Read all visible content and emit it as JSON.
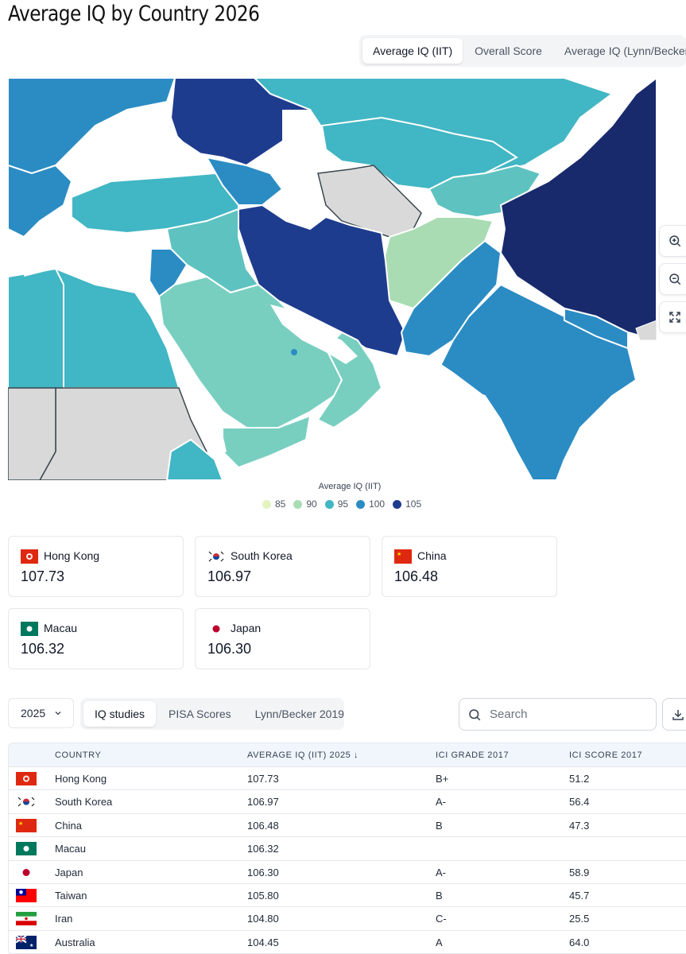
{
  "page_title": "Average IQ by Country 2026",
  "map_tabs": [
    {
      "label": "Average IQ (IIT)",
      "active": true
    },
    {
      "label": "Overall Score",
      "active": false
    },
    {
      "label": "Average IQ (Lynn/Becker)",
      "active": false
    }
  ],
  "map_controls": {
    "zoom_in": "zoom-in-icon",
    "zoom_out": "zoom-out-icon",
    "fullscreen": "expand-icon"
  },
  "legend": {
    "title": "Average IQ (IIT)",
    "items": [
      {
        "label": "85",
        "color": "#e3f4c0"
      },
      {
        "label": "90",
        "color": "#a9dcb3"
      },
      {
        "label": "95",
        "color": "#41b6c4"
      },
      {
        "label": "100",
        "color": "#2b8cc4"
      },
      {
        "label": "105",
        "color": "#1e3c8e"
      }
    ]
  },
  "top_cards": [
    {
      "country": "Hong Kong",
      "value": "107.73",
      "flag": "hong-kong"
    },
    {
      "country": "South Korea",
      "value": "106.97",
      "flag": "south-korea"
    },
    {
      "country": "China",
      "value": "106.48",
      "flag": "china"
    },
    {
      "country": "Macau",
      "value": "106.32",
      "flag": "macau"
    },
    {
      "country": "Japan",
      "value": "106.30",
      "flag": "japan"
    }
  ],
  "controls": {
    "year": "2025",
    "data_tabs": [
      {
        "label": "IQ studies",
        "active": true
      },
      {
        "label": "PISA Scores",
        "active": false
      },
      {
        "label": "Lynn/Becker 2019",
        "active": false
      }
    ],
    "search_placeholder": "Search"
  },
  "table": {
    "headers": [
      "Country",
      "Average IQ (IIT) 2025 ↓",
      "ICI Grade 2017",
      "ICI Score 2017"
    ],
    "rows": [
      {
        "country": "Hong Kong",
        "iq": "107.73",
        "grade": "B+",
        "score": "51.2",
        "flag": "hong-kong"
      },
      {
        "country": "South Korea",
        "iq": "106.97",
        "grade": "A-",
        "score": "56.4",
        "flag": "south-korea"
      },
      {
        "country": "China",
        "iq": "106.48",
        "grade": "B",
        "score": "47.3",
        "flag": "china"
      },
      {
        "country": "Macau",
        "iq": "106.32",
        "grade": "",
        "score": "",
        "flag": "macau"
      },
      {
        "country": "Japan",
        "iq": "106.30",
        "grade": "A-",
        "score": "58.9",
        "flag": "japan"
      },
      {
        "country": "Taiwan",
        "iq": "105.80",
        "grade": "B",
        "score": "45.7",
        "flag": "taiwan"
      },
      {
        "country": "Iran",
        "iq": "104.80",
        "grade": "C-",
        "score": "25.5",
        "flag": "iran"
      },
      {
        "country": "Australia",
        "iq": "104.45",
        "grade": "A",
        "score": "64.0",
        "flag": "australia"
      }
    ]
  }
}
